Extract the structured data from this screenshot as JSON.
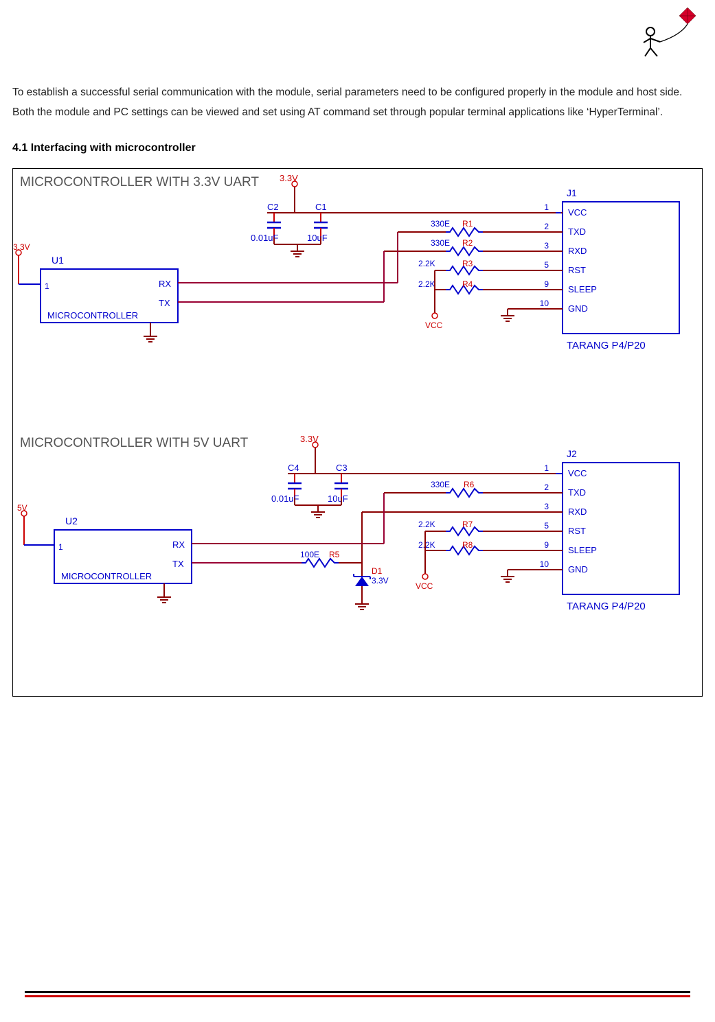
{
  "intro_paragraph": "To establish a successful serial communication with the module, serial parameters need to be configured properly in the module and host side. Both the module and PC settings can be viewed and set using AT command set through popular terminal applications like ‘HyperTerminal’.",
  "section_heading": "4.1 Interfacing with microcontroller",
  "schematic": {
    "top": {
      "title": "MICROCONTROLLER WITH 3.3V UART",
      "supply": "3.3V",
      "mcu_supply": "3.3V",
      "mcu_ref": "U1",
      "mcu_name": "MICROCONTROLLER",
      "mcu_pin1": "1",
      "mcu_rx": "RX",
      "mcu_tx": "TX",
      "caps": {
        "c1_ref": "C1",
        "c1_val": "10uF",
        "c2_ref": "C2",
        "c2_val": "0.01uF"
      },
      "resistors": {
        "r1": "330E",
        "r1_ref": "R1",
        "r2": "330E",
        "r2_ref": "R2",
        "r3": "2.2K",
        "r3_ref": "R3",
        "r4": "2.2K",
        "r4_ref": "R4"
      },
      "vcc_label": "VCC",
      "connector": {
        "ref": "J1",
        "pins": [
          {
            "num": "1",
            "name": "VCC"
          },
          {
            "num": "2",
            "name": "TXD"
          },
          {
            "num": "3",
            "name": "RXD"
          },
          {
            "num": "5",
            "name": "RST"
          },
          {
            "num": "9",
            "name": "SLEEP"
          },
          {
            "num": "10",
            "name": "GND"
          }
        ],
        "module_name": "TARANG P4/P20"
      }
    },
    "bottom": {
      "title": "MICROCONTROLLER WITH 5V UART",
      "supply": "3.3V",
      "mcu_supply": "5V",
      "mcu_ref": "U2",
      "mcu_name": "MICROCONTROLLER",
      "mcu_pin1": "1",
      "mcu_rx": "RX",
      "mcu_tx": "TX",
      "caps": {
        "c3_ref": "C3",
        "c3_val": "10uF",
        "c4_ref": "C4",
        "c4_val": "0.01uF"
      },
      "resistors": {
        "r5": "100E",
        "r5_ref": "R5",
        "r6": "330E",
        "r6_ref": "R6",
        "r7": "2.2K",
        "r7_ref": "R7",
        "r8": "2.2K",
        "r8_ref": "R8"
      },
      "diode": {
        "ref": "D1",
        "val": "3.3V"
      },
      "vcc_label": "VCC",
      "connector": {
        "ref": "J2",
        "pins": [
          {
            "num": "1",
            "name": "VCC"
          },
          {
            "num": "2",
            "name": "TXD"
          },
          {
            "num": "3",
            "name": "RXD"
          },
          {
            "num": "5",
            "name": "RST"
          },
          {
            "num": "9",
            "name": "SLEEP"
          },
          {
            "num": "10",
            "name": "GND"
          }
        ],
        "module_name": "TARANG P4/P20"
      }
    }
  }
}
